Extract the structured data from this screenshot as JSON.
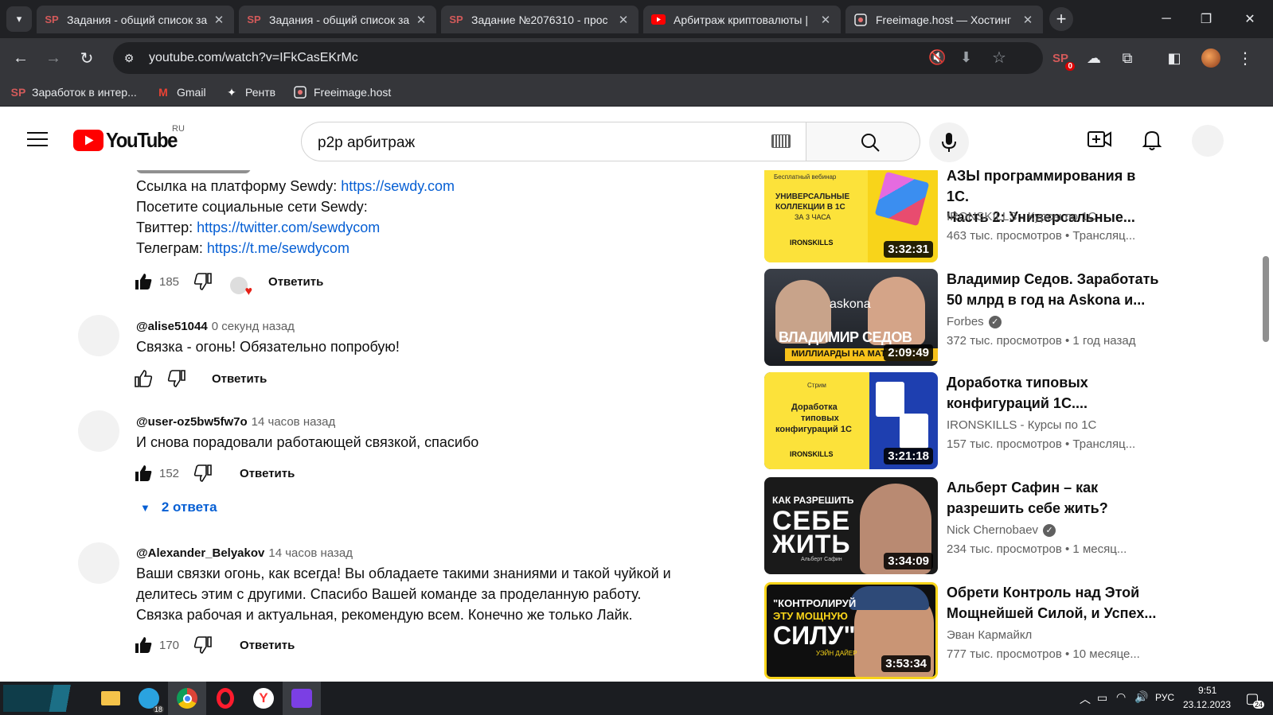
{
  "browser": {
    "tabs": [
      {
        "title": "Задания - общий список за",
        "icon": "sp-icon"
      },
      {
        "title": "Задания - общий список за",
        "icon": "sp-icon"
      },
      {
        "title": "Задание №2076310 - прос",
        "icon": "sp-icon"
      },
      {
        "title": "Арбитраж криптовалюты |",
        "icon": "youtube-icon",
        "active": true
      },
      {
        "title": "Freeimage.host — Хостинг",
        "icon": "freeimage-icon"
      }
    ],
    "url": "youtube.com/watch?v=IFkCasEKrMc",
    "extension_badge": "0",
    "bookmarks": [
      {
        "label": "Заработок в интер...",
        "icon": "sp-icon"
      },
      {
        "label": "Gmail",
        "icon": "gmail-icon"
      },
      {
        "label": "Рентв",
        "icon": "rentv-icon"
      },
      {
        "label": "Freeimage.host",
        "icon": "freeimage-icon"
      }
    ]
  },
  "youtube": {
    "logo_text": "YouTube",
    "region": "RU",
    "search_value": "p2p арбитраж"
  },
  "comments": {
    "top_partial": {
      "lines": [
        {
          "prefix": "Ссылка на платформу Sewdy: ",
          "link": "https://sewdy.com"
        },
        {
          "prefix": "Посетите социальные сети Sewdy:",
          "link": ""
        },
        {
          "prefix": "Твиттер: ",
          "link": "https://twitter.com/sewdycom"
        },
        {
          "prefix": "Телеграм: ",
          "link": "https://t.me/sewdycom"
        }
      ],
      "likes": "185",
      "reply": "Ответить"
    },
    "items": [
      {
        "author": "@alise51044",
        "time": "0 секунд назад",
        "text": [
          "Связка - огонь! Обязательно попробую!"
        ],
        "likes": "",
        "reply": "Ответить"
      },
      {
        "author": "@user-oz5bw5fw7o",
        "time": "14 часов назад",
        "text": [
          "И снова порадовали работающей связкой, спасибо"
        ],
        "likes": "152",
        "reply": "Ответить",
        "replies": "2 ответа"
      },
      {
        "author": "@Alexander_Belyakov",
        "time": "14 часов назад",
        "text": [
          "Ваши связки огонь, как всегда! Вы обладаете такими знаниями и такой чуйкой и",
          "делитесь этим с другими. Спасибо Вашей команде за проделанную работу.",
          "Связка рабочая и актуальная, рекомендую всем. Конечно же только Лайк."
        ],
        "likes": "170",
        "reply": "Ответить"
      }
    ]
  },
  "related": [
    {
      "title": [
        "АЗЫ программирования в 1С.",
        "Часть 2: Универсальные..."
      ],
      "channel": "IRONSKILLS - Курсы по 1С",
      "verified": false,
      "views": "463 тыс. просмотров",
      "age": "• Трансляц...",
      "duration": "3:32:31",
      "thumb_text": [
        "Бесплатный вебинар",
        "УНИВЕРСАЛЬНЫЕ",
        "КОЛЛЕКЦИИ В 1С",
        "ЗА 3 ЧАСА",
        "IRONSKILLS"
      ]
    },
    {
      "title": [
        "Владимир Седов. Заработать",
        "50 млрд в год на Askona и..."
      ],
      "channel": "Forbes",
      "verified": true,
      "views": "372 тыс. просмотров",
      "age": "• 1 год назад",
      "duration": "2:09:49",
      "thumb_text": [
        "askona",
        "ВЛАДИМИР СЕДОВ",
        "МИЛЛИАРДЫ НА МАТ"
      ]
    },
    {
      "title": [
        "Доработка типовых",
        "конфигураций 1С...."
      ],
      "channel": "IRONSKILLS - Курсы по 1С",
      "verified": false,
      "views": "157 тыс. просмотров",
      "age": "• Трансляц...",
      "duration": "3:21:18",
      "thumb_text": [
        "Стрим",
        "Доработка",
        "типовых",
        "конфигураций 1С",
        "IRONSKILLS"
      ]
    },
    {
      "title": [
        "Альберт Сафин – как",
        "разрешить себе жить?"
      ],
      "channel": "Nick Chernobaev",
      "verified": true,
      "views": "234 тыс. просмотров",
      "age": "• 1 месяц...",
      "duration": "3:34:09",
      "thumb_text": [
        "КАК РАЗРЕШИТЬ",
        "СЕБЕ",
        "ЖИТЬ",
        "Альберт Сафин"
      ]
    },
    {
      "title": [
        "Обрети Контроль над Этой",
        "Мощнейшей Силой, и Успех..."
      ],
      "channel": "Эван Кармайкл",
      "verified": false,
      "views": "777 тыс. просмотров",
      "age": "• 10 месяце...",
      "duration": "3:53:34",
      "thumb_text": [
        "\"КОНТРОЛИРУЙ",
        "ЭТУ МОЩНУЮ",
        "СИЛУ\"",
        "УЭЙН ДАЙЕР"
      ]
    }
  ],
  "taskbar": {
    "telegram_badge": "18",
    "lang": "РУС",
    "time": "9:51",
    "date": "23.12.2023",
    "notif_count": "24"
  },
  "colors": {
    "youtube_red": "#ff0000",
    "link_blue": "#065fd4",
    "heart_red": "#e62117"
  }
}
